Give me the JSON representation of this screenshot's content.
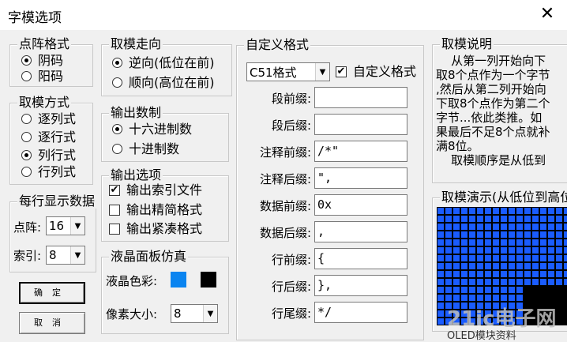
{
  "window": {
    "title": "字模选项",
    "close_glyph": "✕"
  },
  "dot_format": {
    "legend": "点阵格式",
    "options": [
      {
        "label": "阴码",
        "selected": true
      },
      {
        "label": "阳码",
        "selected": false
      }
    ]
  },
  "scan_mode": {
    "legend": "取模方式",
    "options": [
      {
        "label": "逐列式",
        "selected": false
      },
      {
        "label": "逐行式",
        "selected": false
      },
      {
        "label": "列行式",
        "selected": true
      },
      {
        "label": "行列式",
        "selected": false
      }
    ]
  },
  "per_line": {
    "legend": "每行显示数据",
    "dots_label": "点阵:",
    "dots_value": "16",
    "index_label": "索引:",
    "index_value": "8"
  },
  "direction": {
    "legend": "取模走向",
    "options": [
      {
        "label": "逆向(低位在前)",
        "selected": true
      },
      {
        "label": "顺向(高位在前)",
        "selected": false
      }
    ]
  },
  "number_system": {
    "legend": "输出数制",
    "options": [
      {
        "label": "十六进制数",
        "selected": true
      },
      {
        "label": "十进制数",
        "selected": false
      }
    ]
  },
  "output_options": {
    "legend": "输出选项",
    "items": [
      {
        "label": "输出索引文件",
        "checked": true
      },
      {
        "label": "输出精简格式",
        "checked": false
      },
      {
        "label": "输出紧凑格式",
        "checked": false
      }
    ]
  },
  "lcd": {
    "legend": "液晶面板仿真",
    "color_label": "液晶色彩:",
    "colors": {
      "fg": "#0a84f0",
      "bg": "#000000"
    },
    "pixel_label": "像素大小:",
    "pixel_value": "8"
  },
  "custom": {
    "legend": "自定义格式",
    "format_value": "C51格式",
    "custom_check_label": "自定义格式",
    "custom_checked": true,
    "fields": [
      {
        "label": "段前缀:",
        "value": ""
      },
      {
        "label": "段后缀:",
        "value": ""
      },
      {
        "label": "注释前缀:",
        "value": "/*\""
      },
      {
        "label": "注释后缀:",
        "value": "\","
      },
      {
        "label": "数据前缀:",
        "value": "0x"
      },
      {
        "label": "数据后缀:",
        "value": ","
      },
      {
        "label": "行前缀:",
        "value": "{"
      },
      {
        "label": "行后缀:",
        "value": "},"
      },
      {
        "label": "行尾缀:",
        "value": "*/"
      }
    ]
  },
  "buttons": {
    "ok": "确定",
    "cancel": "取消"
  },
  "explain": {
    "legend": "取模说明",
    "lines": [
      "    从第一列开始向下",
      "取8个点作为一个字节",
      ",然后从第二列开始向",
      "下取8个点作为第二个",
      "字节...依此类推。如",
      "果最后不足8个点就补",
      "满8位。",
      "    取模顺序是从低到"
    ]
  },
  "demo": {
    "legend": "取模演示(从低位到高位)",
    "grid_color": "#1a5cff",
    "mark_color": "#000000"
  },
  "watermark": {
    "text": "21ic电子网",
    "sub": "OLED模块资料"
  }
}
